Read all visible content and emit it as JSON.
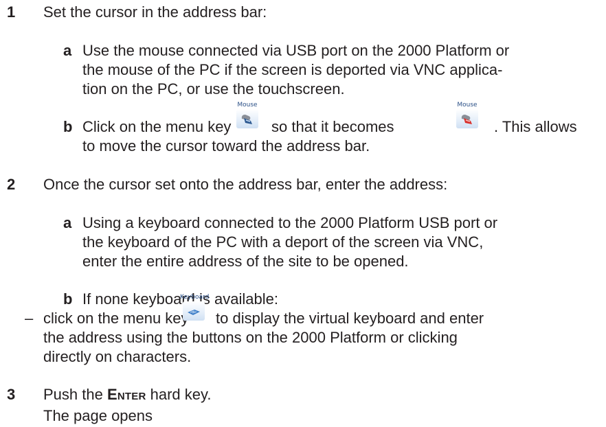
{
  "steps": {
    "s1": {
      "num": "1",
      "text": "Set the cursor in the address bar:",
      "a": {
        "label": "a",
        "l1": "Use the mouse connected via USB port on the 2000 Platform or",
        "l2": "the mouse of the PC if the screen is deported via VNC applica-",
        "l3": "tion on the PC, or use the touchscreen."
      },
      "b": {
        "label": "b",
        "pre": "Click on the menu key",
        "mid": "so that it becomes",
        "post": ". This allows",
        "l2": "to move the cursor toward the address bar."
      }
    },
    "s2": {
      "num": "2",
      "text": "Once the cursor set onto the address bar, enter the address:",
      "a": {
        "label": "a",
        "l1": "Using a keyboard connected to the 2000 Platform USB port or",
        "l2": "the keyboard of the PC with a deport of the screen via VNC,",
        "l3": "enter the entire address of the site to be opened."
      },
      "b": {
        "label": "b",
        "text": "If none keyboard is available:"
      },
      "dash": {
        "bullet": "–",
        "pre": "click on the menu key",
        "post": "to display the virtual keyboard and enter",
        "l2": "the address using the buttons on the 2000 Platform or clicking",
        "l3": "directly on characters."
      }
    },
    "s3": {
      "num": "3",
      "pre": "Push the",
      "key_first": "E",
      "key_rest": "NTER",
      "post": "hard key.",
      "result": "The page opens"
    }
  },
  "icons": {
    "mouse_off": {
      "caption": "Mouse",
      "name": "mouse-icon"
    },
    "mouse_on": {
      "caption": "Mouse",
      "name": "mouse-active-icon"
    },
    "keyboard": {
      "caption": "Keyboard",
      "name": "keyboard-icon"
    }
  },
  "colors": {
    "text": "#231f20",
    "icon_caption": "#2a4f86",
    "icon_tile": "#e4eef9",
    "mouse_active": "#d9302c"
  }
}
